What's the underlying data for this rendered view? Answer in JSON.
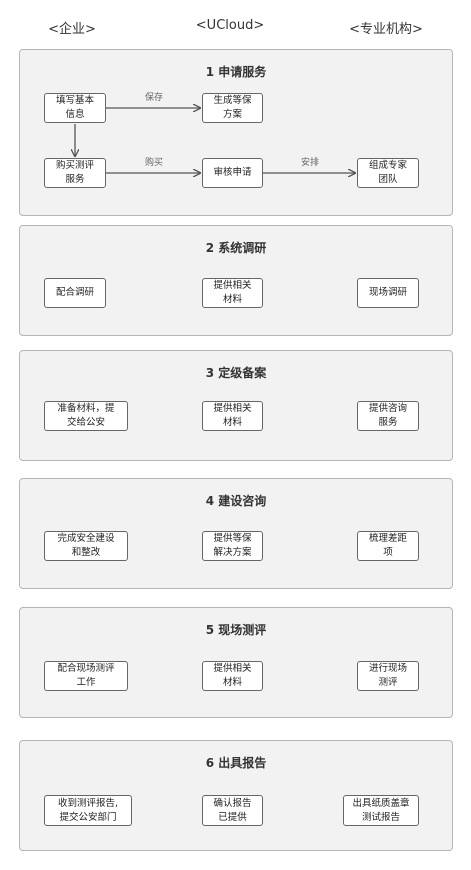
{
  "columns": {
    "enterprise": "<企业>",
    "ucloud": "<UCloud>",
    "agency": "<专业机构>"
  },
  "panels": [
    {
      "title": "1 申请服务",
      "nodes": {
        "fill_info": "填写基本\n信息",
        "gen_plan": "生成等保\n方案",
        "buy_eval": "购买测评\n服务",
        "review": "审核申请",
        "team": "组成专家\n团队"
      },
      "edges": {
        "save": "保存",
        "buy": "购买",
        "arrange": "安排"
      }
    },
    {
      "title": "2 系统调研",
      "left": "配合调研",
      "center": "提供相关\n材料",
      "right": "现场调研"
    },
    {
      "title": "3 定级备案",
      "left": "准备材料，提\n交给公安",
      "center": "提供相关\n材料",
      "right": "提供咨询\n服务"
    },
    {
      "title": "4 建设咨询",
      "left": "完成安全建设\n和整改",
      "center": "提供等保\n解决方案",
      "right": "梳理差距\n项"
    },
    {
      "title": "5 现场测评",
      "left": "配合现场测评\n工作",
      "center": "提供相关\n材料",
      "right": "进行现场\n测评"
    },
    {
      "title": "6 出具报告",
      "left": "收到测评报告,\n提交公安部门",
      "center": "确认报告\n已提供",
      "right": "出具纸质盖章\n测试报告"
    }
  ]
}
